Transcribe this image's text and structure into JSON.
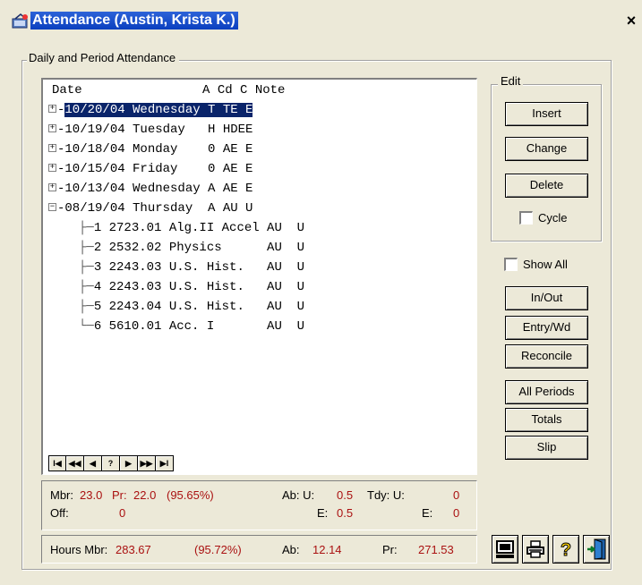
{
  "window": {
    "title": "Attendance (Austin, Krista K.)",
    "close_glyph": "×"
  },
  "group_label": "Daily and Period Attendance",
  "tree": {
    "header": "Date                A Cd C Note",
    "rows": [
      {
        "expander": "+",
        "text": "10/20/04 Wednesday T TE E",
        "selected": true
      },
      {
        "expander": "+",
        "text": "10/19/04 Tuesday   H HDEE",
        "selected": false
      },
      {
        "expander": "+",
        "text": "10/18/04 Monday    0 AE E",
        "selected": false
      },
      {
        "expander": "+",
        "text": "10/15/04 Friday    0 AE E",
        "selected": false
      },
      {
        "expander": "+",
        "text": "10/13/04 Wednesday A AE E",
        "selected": false
      },
      {
        "expander": "−",
        "text": "08/19/04 Thursday  A AU U",
        "selected": false
      }
    ],
    "children": [
      {
        "text": "1 2723.01 Alg.II Accel AU  U"
      },
      {
        "text": "2 2532.02 Physics      AU  U"
      },
      {
        "text": "3 2243.03 U.S. Hist.   AU  U"
      },
      {
        "text": "4 2243.03 U.S. Hist.   AU  U"
      },
      {
        "text": "5 2243.04 U.S. Hist.   AU  U"
      },
      {
        "text": "6 5610.01 Acc. I       AU  U"
      }
    ]
  },
  "nav": {
    "first": "I◀",
    "prev_page": "◀◀",
    "prev": "◀",
    "help": "?",
    "next": "▶",
    "next_page": "▶▶",
    "last": "▶I"
  },
  "summary": {
    "mbr_label": "Mbr:",
    "mbr_value": "23.0",
    "pr_label": "Pr:",
    "pr_value": "22.0",
    "pr_pct": "(95.65%)",
    "ab_u_label": "Ab: U:",
    "ab_u_value": "0.5",
    "tdy_u_label": "Tdy: U:",
    "tdy_u_value": "0",
    "off_label": "Off:",
    "off_value": "0",
    "ab_e_label": "E:",
    "ab_e_value": "0.5",
    "tdy_e_label": "E:",
    "tdy_e_value": "0"
  },
  "hours": {
    "mbr_label": "Hours Mbr:",
    "mbr_value": "283.67",
    "pct": "(95.72%)",
    "ab_label": "Ab:",
    "ab_value": "12.14",
    "pr_label": "Pr:",
    "pr_value": "271.53"
  },
  "edit": {
    "label": "Edit",
    "insert": "Insert",
    "change": "Change",
    "delete": "Delete",
    "cycle": "Cycle"
  },
  "show_all": "Show All",
  "buttons": {
    "in_out": "In/Out",
    "entry_wd": "Entry/Wd",
    "reconcile": "Reconcile",
    "all_periods": "All Periods",
    "totals": "Totals",
    "slip": "Slip"
  },
  "icons": [
    "computer-icon",
    "printer-icon",
    "help-icon",
    "exit-door-icon"
  ]
}
